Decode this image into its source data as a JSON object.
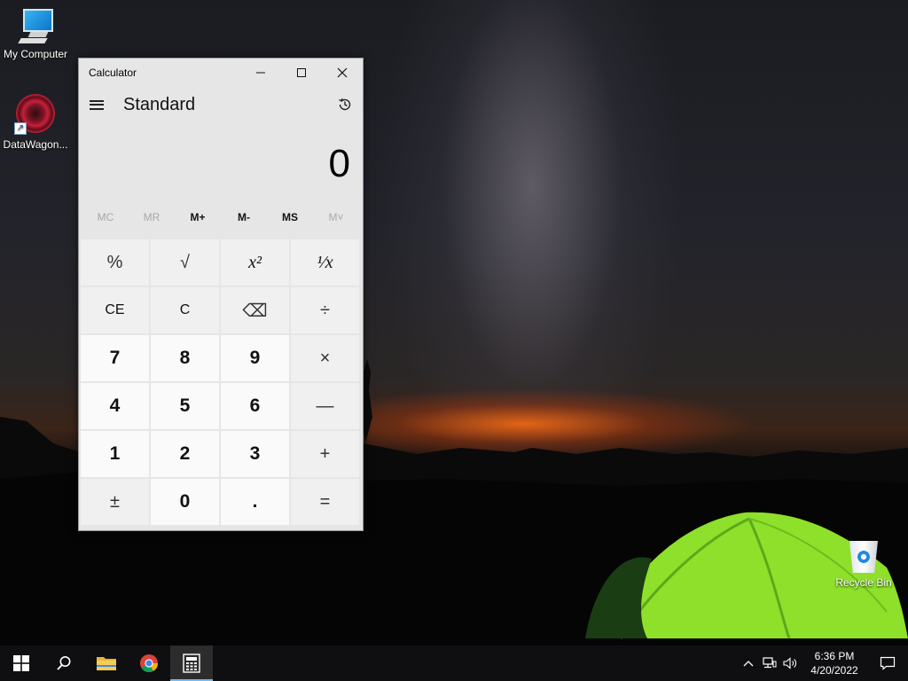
{
  "desktop": {
    "icons": [
      {
        "label": "My Computer"
      },
      {
        "label": "DataWagon..."
      },
      {
        "label": "Recycle Bin"
      }
    ]
  },
  "calculator": {
    "window_title": "Calculator",
    "mode_title": "Standard",
    "display_value": "0",
    "memory_buttons": [
      {
        "label": "MC",
        "enabled": false
      },
      {
        "label": "MR",
        "enabled": false
      },
      {
        "label": "M+",
        "enabled": true
      },
      {
        "label": "M-",
        "enabled": true
      },
      {
        "label": "MS",
        "enabled": true
      },
      {
        "label": "M˅",
        "enabled": false
      }
    ],
    "keys": {
      "percent": "%",
      "sqrt": "√",
      "square": "x²",
      "reciprocal": "¹⁄x",
      "ce": "CE",
      "clear": "C",
      "backspace": "⌫",
      "divide": "÷",
      "seven": "7",
      "eight": "8",
      "nine": "9",
      "multiply": "×",
      "four": "4",
      "five": "5",
      "six": "6",
      "minus": "—",
      "one": "1",
      "two": "2",
      "three": "3",
      "plus": "+",
      "negate": "±",
      "zero": "0",
      "decimal": ".",
      "equals": "="
    }
  },
  "taskbar": {
    "time": "6:36 PM",
    "date": "4/20/2022",
    "pinned": [
      "windows-start",
      "search",
      "file-explorer",
      "chrome",
      "calculator"
    ],
    "active_app": "calculator"
  },
  "colors": {
    "taskbar_accent": "#76b9ed",
    "tent_green": "#8ee02a",
    "horizon_orange": "#ff6e14"
  }
}
